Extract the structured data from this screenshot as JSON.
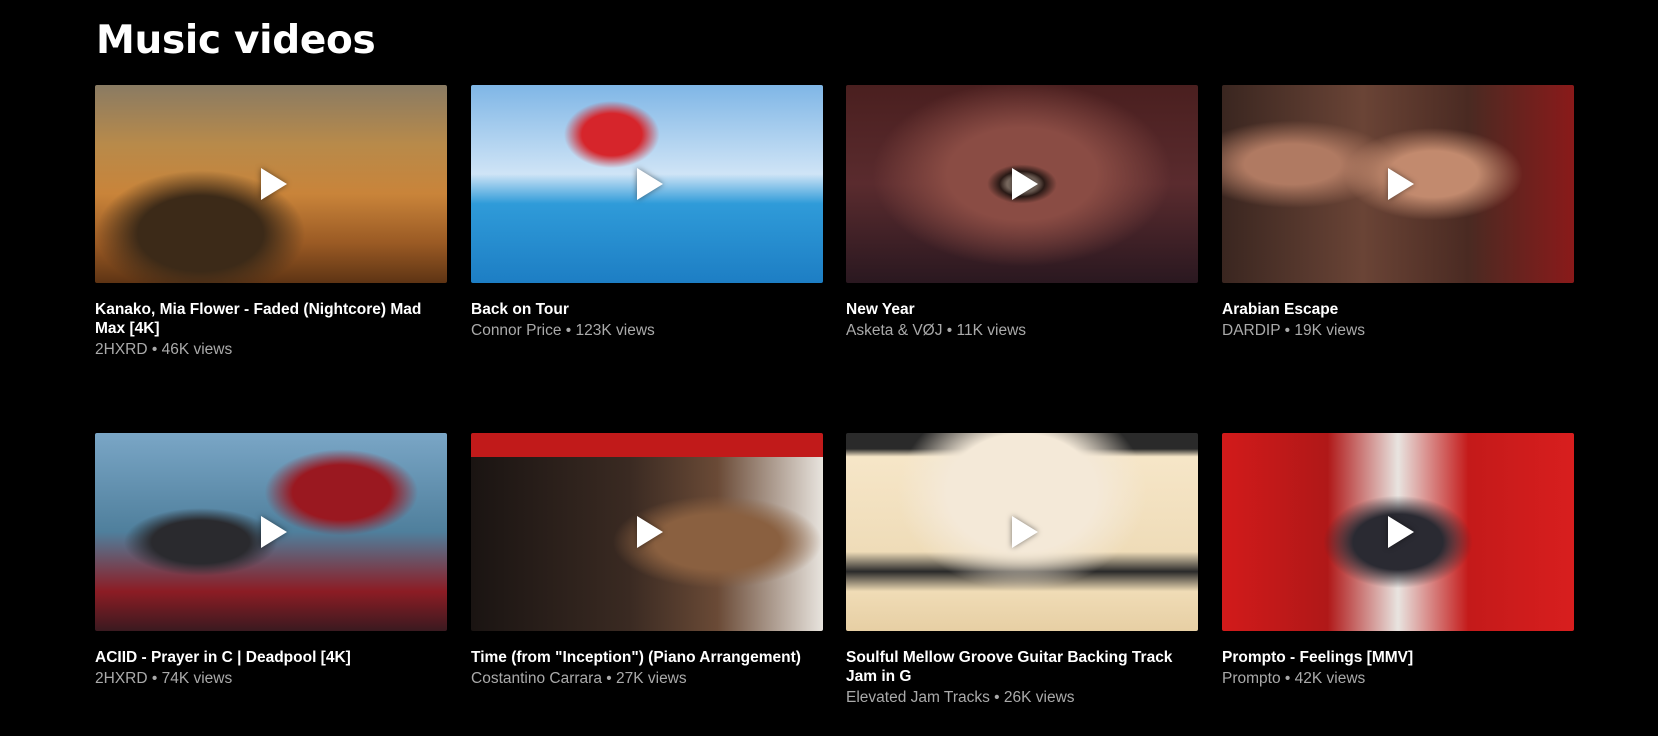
{
  "section": {
    "title": "Music videos"
  },
  "videos": [
    {
      "title": "Kanako, Mia Flower - Faded (Nightcore) Mad Max [4K]",
      "channel": "2HXRD",
      "views": "46K views",
      "meta": "2HXRD • 46K views"
    },
    {
      "title": "Back on Tour",
      "channel": "Connor Price",
      "views": "123K views",
      "meta": "Connor Price • 123K views"
    },
    {
      "title": "New Year",
      "channel": "Asketa & VØJ",
      "views": "11K views",
      "meta": "Asketa & VØJ • 11K views"
    },
    {
      "title": "Arabian Escape",
      "channel": "DARDIP",
      "views": "19K views",
      "meta": "DARDIP • 19K views"
    },
    {
      "title": "ACIID - Prayer in C | Deadpool [4K]",
      "channel": "2HXRD",
      "views": "74K views",
      "meta": "2HXRD • 74K views"
    },
    {
      "title": "Time (from \"Inception\") (Piano Arrangement)",
      "channel": "Costantino Carrara",
      "views": "27K views",
      "meta": "Costantino Carrara • 27K views"
    },
    {
      "title": "Soulful Mellow Groove Guitar Backing Track Jam in G",
      "channel": "Elevated Jam Tracks",
      "views": "26K views",
      "meta": "Elevated Jam Tracks • 26K views"
    },
    {
      "title": "Prompto - Feelings [MMV]",
      "channel": "Prompto",
      "views": "42K views",
      "meta": "Prompto • 42K views"
    }
  ],
  "icons": {
    "play": "play-icon"
  },
  "colors": {
    "background": "#000000",
    "title_text": "#ffffff",
    "meta_text": "#aaaaaa"
  }
}
